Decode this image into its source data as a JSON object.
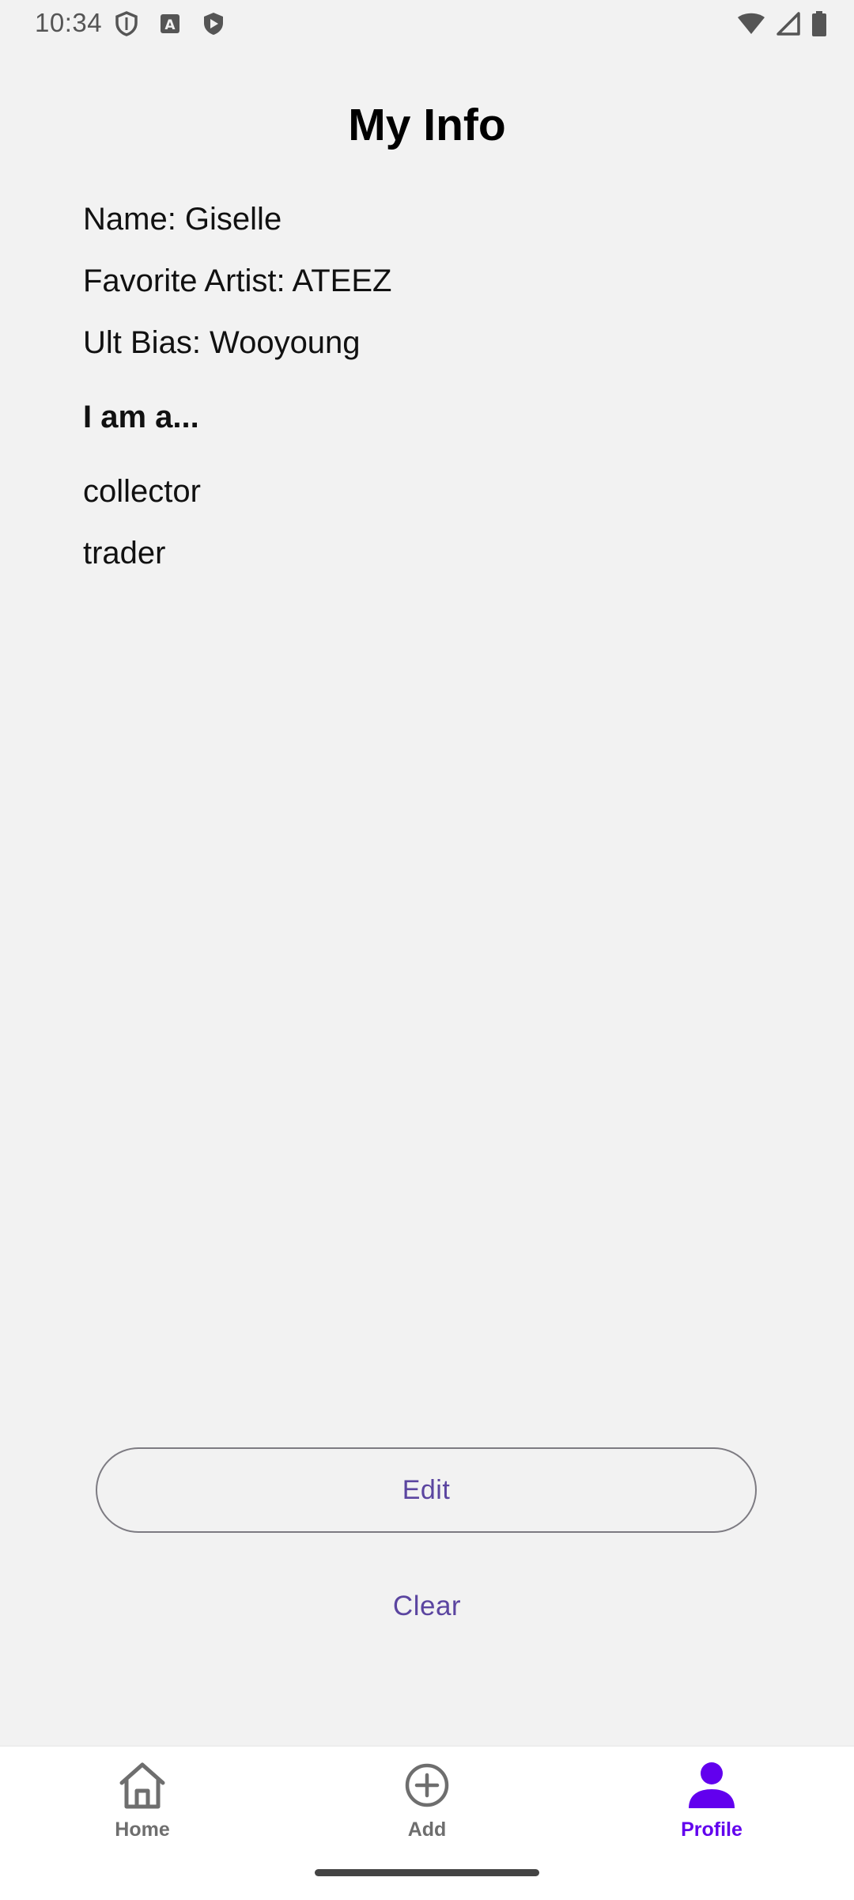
{
  "status_bar": {
    "time": "10:34",
    "left_icons": [
      "shield-icon",
      "keyboard-a-icon",
      "play-shield-icon"
    ],
    "right_icons": [
      "wifi-icon",
      "signal-icon",
      "battery-icon"
    ]
  },
  "page": {
    "title": "My Info"
  },
  "info": {
    "name": "Name: Giselle",
    "favorite_artist": "Favorite Artist: ATEEZ",
    "ult_bias": "Ult Bias: Wooyoung"
  },
  "roles": {
    "heading": "I am a...",
    "items": [
      "collector",
      "trader"
    ]
  },
  "actions": {
    "edit_label": "Edit",
    "clear_label": "Clear"
  },
  "bottom_nav": {
    "items": [
      {
        "label": "Home",
        "icon": "home-icon",
        "active": false
      },
      {
        "label": "Add",
        "icon": "add-circle-icon",
        "active": false
      },
      {
        "label": "Profile",
        "icon": "person-icon",
        "active": true
      }
    ]
  },
  "colors": {
    "background": "#f2f2f2",
    "accent": "#6200ee",
    "button_text": "#5b45a0",
    "nav_inactive": "#6e6e6e"
  }
}
